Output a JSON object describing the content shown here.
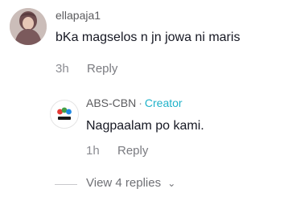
{
  "comments": [
    {
      "username": "ellapaja1",
      "text": "bKa magselos n jn jowa ni maris",
      "time": "3h",
      "reply_label": "Reply",
      "avatar_icon": "profile-photo"
    }
  ],
  "reply": {
    "username": "ABS-CBN",
    "separator": "·",
    "creator_label": "Creator",
    "text": "Nagpaalam po kami.",
    "time": "1h",
    "reply_label": "Reply",
    "avatar_icon": "abs-cbn-logo"
  },
  "view_replies": {
    "label": "View 4 replies"
  },
  "colors": {
    "creator_accent": "#20b2c9",
    "secondary_text": "#8a8b91",
    "primary_text": "#161823"
  }
}
